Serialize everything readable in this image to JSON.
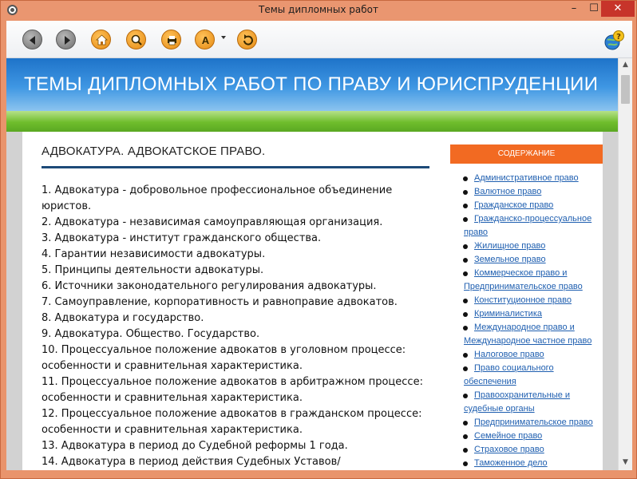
{
  "window": {
    "title": "Темы дипломных работ",
    "minimize": "–",
    "maximize": "☐",
    "close": "✕"
  },
  "toolbar": {
    "buttons": [
      {
        "name": "back",
        "icon": "back-arrow-icon"
      },
      {
        "name": "forward",
        "icon": "forward-arrow-icon"
      },
      {
        "name": "home",
        "icon": "home-icon"
      },
      {
        "name": "search",
        "icon": "search-icon"
      },
      {
        "name": "print",
        "icon": "print-icon"
      },
      {
        "name": "font",
        "icon": "font-icon",
        "label": "A"
      },
      {
        "name": "refresh",
        "icon": "refresh-icon"
      }
    ],
    "help_icon": "help-globe-icon"
  },
  "banner": {
    "title": "ТЕМЫ ДИПЛОМНЫХ РАБОТ ПО ПРАВУ И ЮРИСПРУДЕНЦИИ"
  },
  "article": {
    "title": "АДВОКАТУРА. АДВОКАТСКОЕ ПРАВО.",
    "topics": [
      "1. Адвокатура - добровольное профессиональное объединение юристов.",
      "2. Адвокатура - независимая самоуправляющая организация.",
      "3. Адвокатура - институт гражданского общества.",
      "4. Гарантии независимости адвокатуры.",
      "5. Принципы деятельности адвокатуры.",
      "6. Источники законодательного регулирования адвокатуры.",
      "7. Самоуправление, корпоративность и равноправие адвокатов.",
      "8. Адвокатура и государство.",
      "9. Адвокатура. Общество. Государство.",
      "10. Процессуальное положение адвокатов в уголовном процессе: особенности и сравнительная характеристика.",
      "11. Процессуальное положение адвокатов в арбитражном процессе: особенности и сравнительная характеристика.",
      "12. Процессуальное положение адвокатов в гражданском процессе: особенности и сравнительная характеристика.",
      "13. Адвокатура в период до Судебной реформы 1 года.",
      "14. Адвокатура в период действия Судебных Уставов/"
    ]
  },
  "toc": {
    "heading": "СОДЕРЖАНИЕ",
    "items": [
      "Административное право",
      "Валютное право",
      "Гражданское право",
      "Гражданско-процессуальное право",
      "Жилищное право",
      "Земельное право",
      "Коммерческое право и Предпринимательское право",
      "Конституционное право",
      "Криминалистика",
      "Международное право и Международное частное право",
      "Налоговое право",
      "Право социального обеспечения",
      "Правоохранительные и судебные органы",
      "Предпринимательское право",
      "Семейное право",
      "Страховое право",
      "Таможенное дело"
    ]
  },
  "scrollbar": {
    "up": "▲",
    "down": "▼"
  }
}
